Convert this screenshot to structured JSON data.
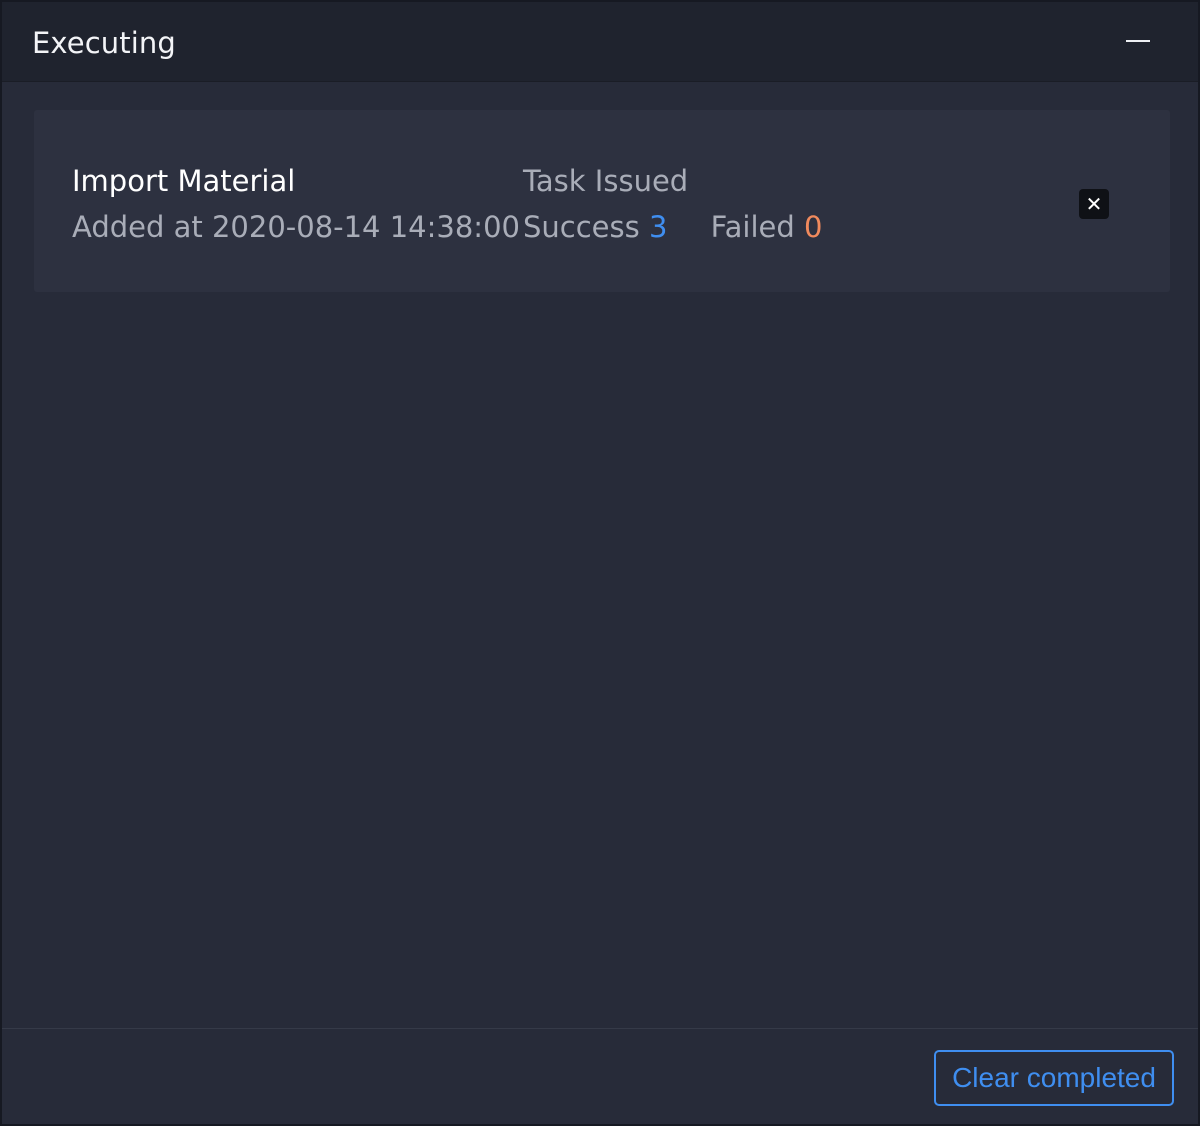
{
  "header": {
    "title": "Executing",
    "minimize_icon": "minimize-icon"
  },
  "tasks": [
    {
      "name": "Import Material",
      "added_at": "Added at 2020-08-14 14:38:00",
      "status": "Task Issued",
      "success_label": "Success",
      "success_count": "3",
      "failed_label": "Failed",
      "failed_count": "0",
      "remove_icon": "close-icon"
    }
  ],
  "footer": {
    "clear_label": "Clear completed"
  },
  "colors": {
    "accent": "#3f8ef0",
    "failed": "#f08a5d",
    "background": "#272b39",
    "header": "#1f232e",
    "card": "#2d3140"
  }
}
